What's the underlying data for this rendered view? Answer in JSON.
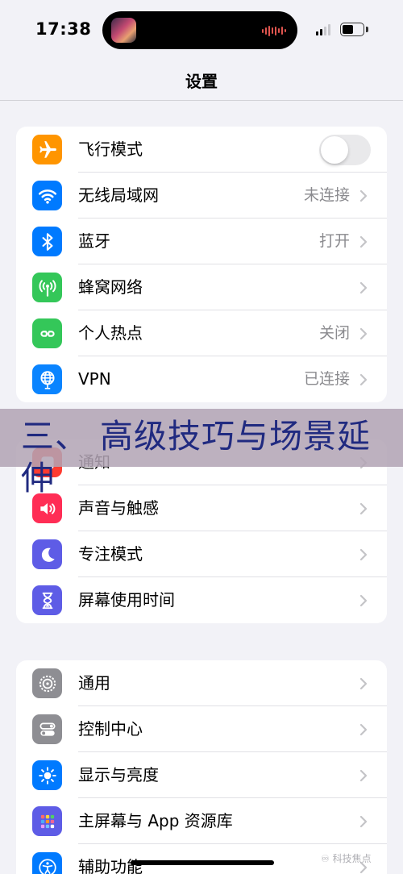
{
  "status": {
    "time": "17:38"
  },
  "nav": {
    "title": "设置"
  },
  "groups": [
    {
      "items": [
        {
          "label": "飞行模式",
          "icon": "airplane-icon",
          "color": "#ff9500",
          "toggle": false
        },
        {
          "label": "无线局域网",
          "icon": "wifi-icon",
          "color": "#007aff",
          "value": "未连接"
        },
        {
          "label": "蓝牙",
          "icon": "bluetooth-icon",
          "color": "#007aff",
          "value": "打开"
        },
        {
          "label": "蜂窝网络",
          "icon": "cellular-icon",
          "color": "#34c759"
        },
        {
          "label": "个人热点",
          "icon": "hotspot-icon",
          "color": "#34c759",
          "value": "关闭"
        },
        {
          "label": "VPN",
          "icon": "vpn-globe-icon",
          "color": "#0a84ff",
          "value": "已连接"
        }
      ]
    },
    {
      "items": [
        {
          "label": "通知",
          "icon": "notification-bell-icon",
          "color": "#ff3b30"
        },
        {
          "label": "声音与触感",
          "icon": "speaker-icon",
          "color": "#ff2d55"
        },
        {
          "label": "专注模式",
          "icon": "moon-icon",
          "color": "#5e5ce6"
        },
        {
          "label": "屏幕使用时间",
          "icon": "hourglass-icon",
          "color": "#5e5ce6"
        }
      ]
    },
    {
      "items": [
        {
          "label": "通用",
          "icon": "gear-icon",
          "color": "#8e8e93"
        },
        {
          "label": "控制中心",
          "icon": "switches-icon",
          "color": "#8e8e93"
        },
        {
          "label": "显示与亮度",
          "icon": "sun-icon",
          "color": "#007aff"
        },
        {
          "label": "主屏幕与 App 资源库",
          "icon": "app-grid-icon",
          "color": "#5e5ce6"
        },
        {
          "label": "辅助功能",
          "icon": "accessibility-icon",
          "color": "#007aff"
        }
      ]
    }
  ],
  "banner": {
    "text": "三、 高级技巧与场景延伸"
  },
  "watermark": {
    "text": "科技焦点"
  }
}
